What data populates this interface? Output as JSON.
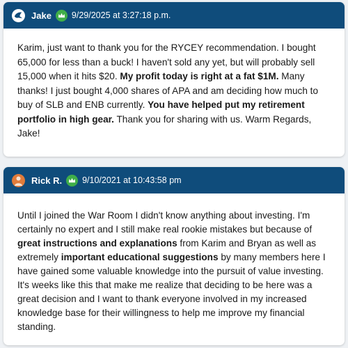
{
  "testimonials": [
    {
      "author": "Jake",
      "timestamp": "9/29/2025 at 3:27:18 p.m.",
      "avatar_icon": "dove-icon",
      "badge_icon": "crown-icon",
      "segments": [
        {
          "text": "Karim, just want to thank you for the RYCEY recommendation. I bought 65,000 for less than a buck! I haven't sold any yet, but will probably sell 15,000 when it hits $20. ",
          "bold": false
        },
        {
          "text": "My profit today is right at a fat $1M.",
          "bold": true
        },
        {
          "text": " Many thanks! I just bought 4,000 shares of APA and am deciding how much to buy of SLB and ENB currently. ",
          "bold": false
        },
        {
          "text": "You have helped put my retirement portfolio in high gear.",
          "bold": true
        },
        {
          "text": " Thank you for sharing with us. Warm Regards, Jake!",
          "bold": false
        }
      ]
    },
    {
      "author": "Rick R.",
      "timestamp": "9/10/2021 at 10:43:58 pm",
      "avatar_icon": "person-avatar-icon",
      "badge_icon": "crown-icon",
      "segments": [
        {
          "text": "Until I joined the War Room I didn't know anything about investing. I'm certainly no expert and I still make real rookie mistakes but because of ",
          "bold": false
        },
        {
          "text": "great instructions and explanations",
          "bold": true
        },
        {
          "text": " from Karim and Bryan as well as extremely ",
          "bold": false
        },
        {
          "text": "important educational suggestions",
          "bold": true
        },
        {
          "text": " by many members here I have gained some valuable knowledge into the pursuit of value investing. It's weeks like this that make me realize that deciding to be here was a great decision and I want to thank everyone involved in my increased knowledge base for their willingness to help me improve my financial standing.",
          "bold": false
        }
      ]
    }
  ],
  "colors": {
    "header_bg": "#0f4c7b",
    "badge_green": "#3fae49",
    "avatar_orange": "#e07b3a"
  }
}
